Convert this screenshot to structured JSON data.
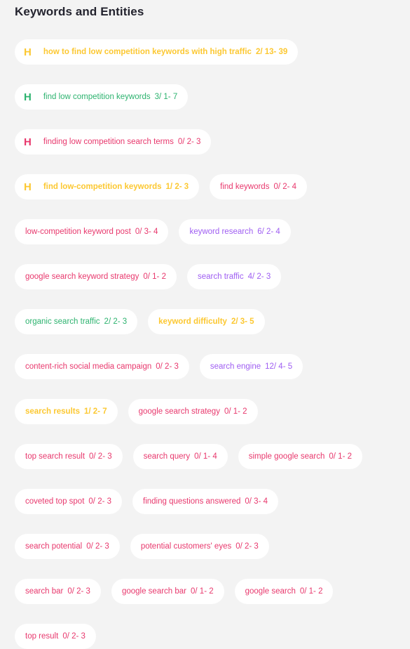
{
  "section": {
    "title": "Keywords and Entities"
  },
  "colors": {
    "yellow": "#fcc832",
    "green": "#2db36f",
    "pink": "#e8386d",
    "purple": "#9f5ef2",
    "background": "#f3f3f3"
  },
  "chips": [
    {
      "heading": "H",
      "keyword": "how to find low competition keywords with high traffic",
      "stats": "2/ 13- 39",
      "color": "yellow"
    },
    {
      "heading": "H",
      "keyword": "find low competition keywords",
      "stats": "3/ 1- 7",
      "color": "green"
    },
    {
      "heading": "H",
      "keyword": "finding low competition search terms",
      "stats": "0/ 2- 3",
      "color": "pink"
    },
    {
      "heading": "H",
      "keyword": "find low-competition keywords",
      "stats": "1/ 2- 3",
      "color": "yellow"
    },
    {
      "heading": "",
      "keyword": "find keywords",
      "stats": "0/ 2- 4",
      "color": "pink"
    },
    {
      "heading": "",
      "keyword": "low-competition keyword post",
      "stats": "0/ 3- 4",
      "color": "pink"
    },
    {
      "heading": "",
      "keyword": "keyword research",
      "stats": "6/ 2- 4",
      "color": "purple"
    },
    {
      "heading": "",
      "keyword": "google search keyword strategy",
      "stats": "0/ 1- 2",
      "color": "pink"
    },
    {
      "heading": "",
      "keyword": "search traffic",
      "stats": "4/ 2- 3",
      "color": "purple"
    },
    {
      "heading": "",
      "keyword": "organic search traffic",
      "stats": "2/ 2- 3",
      "color": "green"
    },
    {
      "heading": "",
      "keyword": "keyword difficulty",
      "stats": "2/ 3- 5",
      "color": "yellow"
    },
    {
      "heading": "",
      "keyword": "content-rich social media campaign",
      "stats": "0/ 2- 3",
      "color": "pink"
    },
    {
      "heading": "",
      "keyword": "search engine",
      "stats": "12/ 4- 5",
      "color": "purple"
    },
    {
      "heading": "",
      "keyword": "search results",
      "stats": "1/ 2- 7",
      "color": "yellow"
    },
    {
      "heading": "",
      "keyword": "google search strategy",
      "stats": "0/ 1- 2",
      "color": "pink"
    },
    {
      "heading": "",
      "keyword": "top search result",
      "stats": "0/ 2- 3",
      "color": "pink"
    },
    {
      "heading": "",
      "keyword": "search query",
      "stats": "0/ 1- 4",
      "color": "pink"
    },
    {
      "heading": "",
      "keyword": "simple google search",
      "stats": "0/ 1- 2",
      "color": "pink"
    },
    {
      "heading": "",
      "keyword": "coveted top spot",
      "stats": "0/ 2- 3",
      "color": "pink"
    },
    {
      "heading": "",
      "keyword": "finding questions answered",
      "stats": "0/ 3- 4",
      "color": "pink"
    },
    {
      "heading": "",
      "keyword": "search potential",
      "stats": "0/ 2- 3",
      "color": "pink"
    },
    {
      "heading": "",
      "keyword": "potential customers' eyes",
      "stats": "0/ 2- 3",
      "color": "pink"
    },
    {
      "heading": "",
      "keyword": "search bar",
      "stats": "0/ 2- 3",
      "color": "pink"
    },
    {
      "heading": "",
      "keyword": "google search bar",
      "stats": "0/ 1- 2",
      "color": "pink"
    },
    {
      "heading": "",
      "keyword": "google search",
      "stats": "0/ 1- 2",
      "color": "pink"
    },
    {
      "heading": "",
      "keyword": "top result",
      "stats": "0/ 2- 3",
      "color": "pink"
    }
  ]
}
